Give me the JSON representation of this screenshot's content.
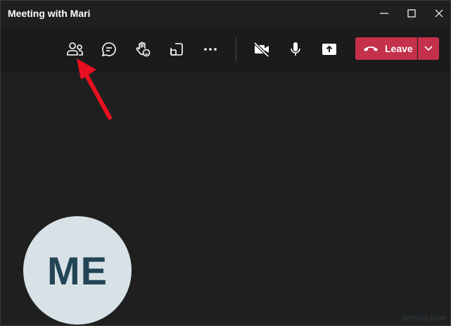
{
  "window": {
    "title": "Meeting with Mari",
    "controls": [
      "minimize-icon",
      "maximize-icon",
      "close-icon"
    ]
  },
  "toolbar": {
    "buttons": [
      {
        "name": "participants",
        "icon": "people-icon"
      },
      {
        "name": "chat",
        "icon": "chat-icon"
      },
      {
        "name": "raise-hand",
        "icon": "hand-icon"
      },
      {
        "name": "share-tray",
        "icon": "picture-in-picture-icon"
      },
      {
        "name": "more-actions",
        "icon": "ellipsis-icon"
      },
      {
        "name": "camera",
        "icon": "camera-off-icon"
      },
      {
        "name": "mic",
        "icon": "microphone-icon"
      },
      {
        "name": "share",
        "icon": "share-upload-icon"
      }
    ],
    "leave_label": "Leave"
  },
  "participant": {
    "initials": "ME"
  },
  "watermark": "de•dsq.com",
  "colors": {
    "leave": "#c4314b",
    "avatar_bg": "#d8e2e6",
    "initials": "#234455",
    "annotation_arrow": "#e8101f"
  }
}
